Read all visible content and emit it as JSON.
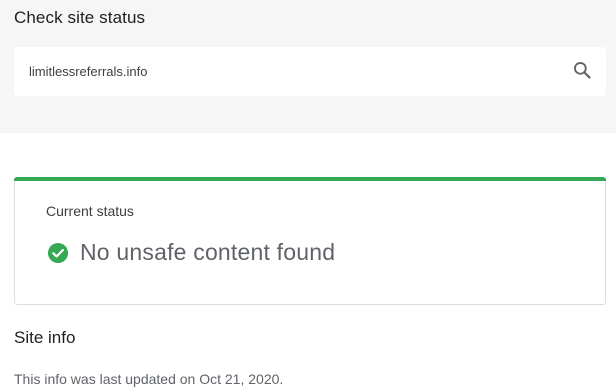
{
  "header": {
    "title": "Check site status"
  },
  "search": {
    "value": "limitlessreferrals.info",
    "icon": "search-icon"
  },
  "status": {
    "label": "Current status",
    "result": "No unsafe content found",
    "icon": "check-circle-icon",
    "accent_color": "#34a853"
  },
  "site_info": {
    "title": "Site info",
    "updated_text": "This info was last updated on Oct 21, 2020."
  }
}
